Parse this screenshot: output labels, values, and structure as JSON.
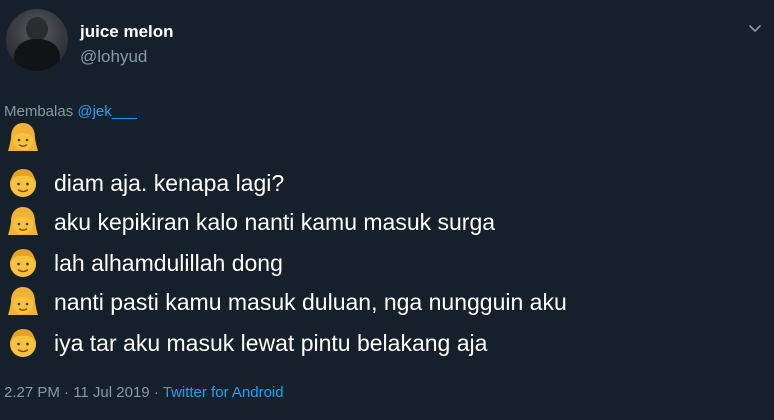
{
  "user": {
    "display_name": "juice melon",
    "handle": "@lohyud"
  },
  "reply": {
    "prefix": "Membalas",
    "mention": "@jek___"
  },
  "conversation": [
    {
      "emoji": "girl-emoji",
      "text": ""
    },
    {
      "emoji": "boy-emoji",
      "text": "diam aja. kenapa lagi?"
    },
    {
      "emoji": "girl-emoji",
      "text": "aku kepikiran kalo nanti kamu masuk surga"
    },
    {
      "emoji": "boy-emoji",
      "text": "lah alhamdulillah dong"
    },
    {
      "emoji": "girl-emoji",
      "text": "nanti pasti kamu masuk duluan, nga nungguin aku"
    },
    {
      "emoji": "boy-emoji",
      "text": "iya tar aku masuk lewat pintu belakang aja"
    }
  ],
  "meta": {
    "timestamp": "2.27 PM · 11 Jul 2019",
    "separator": " · ",
    "source": "Twitter for Android"
  },
  "colors": {
    "background": "#15202b",
    "secondary_text": "#8899a6",
    "link": "#1da1f2"
  }
}
